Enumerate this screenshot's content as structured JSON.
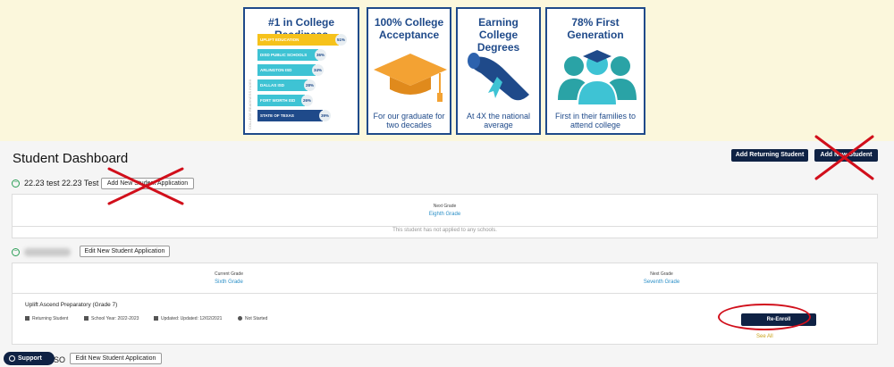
{
  "hero": {
    "readiness": {
      "title": "#1 in College Readiness",
      "side_label": "COLLEGE READINESS INDEX",
      "ranking": [
        {
          "name": "UPLIFT EDUCATION",
          "value": "51%",
          "color": "#f6c21b"
        },
        {
          "name": "DISD PUBLIC SCHOOLS",
          "value": "36%",
          "color": "#3ec3d4"
        },
        {
          "name": "ARLINGTON ISD",
          "value": "34%",
          "color": "#3ec3d4"
        },
        {
          "name": "DALLAS ISD",
          "value": "28%",
          "color": "#3ec3d4"
        },
        {
          "name": "FORT WORTH ISD",
          "value": "26%",
          "color": "#3ec3d4"
        },
        {
          "name": "STATE OF TEXAS",
          "value": "39%",
          "color": "#1f4a8a"
        }
      ]
    },
    "acceptance": {
      "title": "100% College Acceptance",
      "caption": "For our graduate for two decades",
      "icon": "graduation-cap-icon"
    },
    "degrees": {
      "title": "Earning College Degrees",
      "caption": "At 4X the national average",
      "icon": "diploma-icon"
    },
    "first_gen": {
      "title": "78% First Generation",
      "caption": "First in their families to attend college",
      "icon": "family-icon"
    }
  },
  "dashboard": {
    "title": "Student Dashboard",
    "add_returning_label": "Add Returning Student",
    "add_new_label": "Add New Student"
  },
  "students": [
    {
      "name": "22.23 test 22.23 Test",
      "application_button": "Add New Student Application",
      "next_grade_label": "Next Grade",
      "next_grade": "Eighth Grade",
      "status_message": "This student has not applied to any schools."
    },
    {
      "name": "",
      "application_button": "Edit New Student Application",
      "current_grade_label": "Current Grade",
      "current_grade": "Sixth Grade",
      "next_grade_label": "Next Grade",
      "next_grade": "Seventh Grade",
      "school": {
        "name": "Uplift Ascend Preparatory (Grade 7)",
        "type": "Returning Student",
        "school_year": "School Year: 2022-2023",
        "updated": "Updated: Updated: 12/02/2021",
        "status": "Not Started",
        "reenroll_label": "Re-Enroll",
        "see_all_label": "See All"
      }
    },
    {
      "name": "SO",
      "application_button": "Edit New Student Application"
    }
  ],
  "support_label": "Support",
  "colors": {
    "navy": "#0f2244",
    "brand_blue": "#1f4a8a",
    "link": "#2a8fc7",
    "annotation_red": "#d10f1b",
    "hero_bg": "#fbf7dc"
  }
}
